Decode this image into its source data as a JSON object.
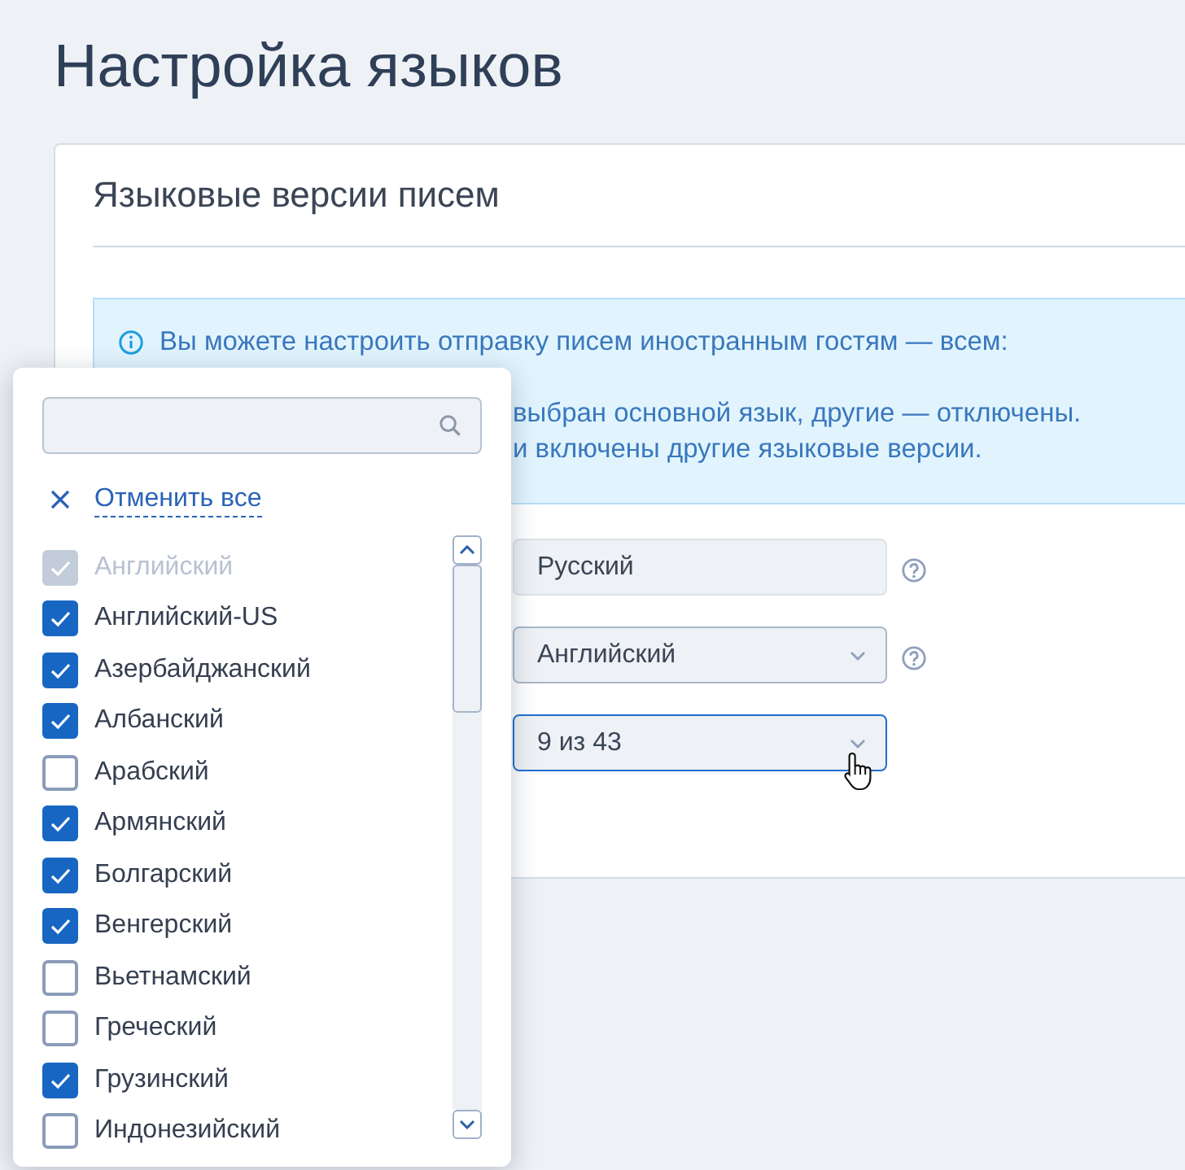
{
  "page": {
    "title": "Настройка языков"
  },
  "card": {
    "title": "Языковые версии писем",
    "notice": {
      "lines": [
        "Вы можете настроить отправку писем иностранным гостям — всем:",
        "выбран основной язык, другие — отключены.",
        "и включены другие языковые версии."
      ]
    },
    "fields": [
      {
        "kind": "readonly",
        "value": "Русский",
        "help": true,
        "focused": false
      },
      {
        "kind": "select",
        "value": "Английский",
        "help": true,
        "focused": false
      },
      {
        "kind": "select",
        "value": "9 из 43",
        "help": false,
        "focused": true
      }
    ]
  },
  "dropdown": {
    "clear_label": "Отменить все",
    "items": [
      {
        "label": "Английский",
        "checked": true,
        "disabled": true
      },
      {
        "label": "Английский-US",
        "checked": true,
        "disabled": false
      },
      {
        "label": "Азербайджанский",
        "checked": true,
        "disabled": false
      },
      {
        "label": "Албанский",
        "checked": true,
        "disabled": false
      },
      {
        "label": "Арабский",
        "checked": false,
        "disabled": false
      },
      {
        "label": "Армянский",
        "checked": true,
        "disabled": false
      },
      {
        "label": "Болгарский",
        "checked": true,
        "disabled": false
      },
      {
        "label": "Венгерский",
        "checked": true,
        "disabled": false
      },
      {
        "label": "Вьетнамский",
        "checked": false,
        "disabled": false
      },
      {
        "label": "Греческий",
        "checked": false,
        "disabled": false
      },
      {
        "label": "Грузинский",
        "checked": true,
        "disabled": false
      },
      {
        "label": "Индонезийский",
        "checked": false,
        "disabled": false
      }
    ]
  }
}
